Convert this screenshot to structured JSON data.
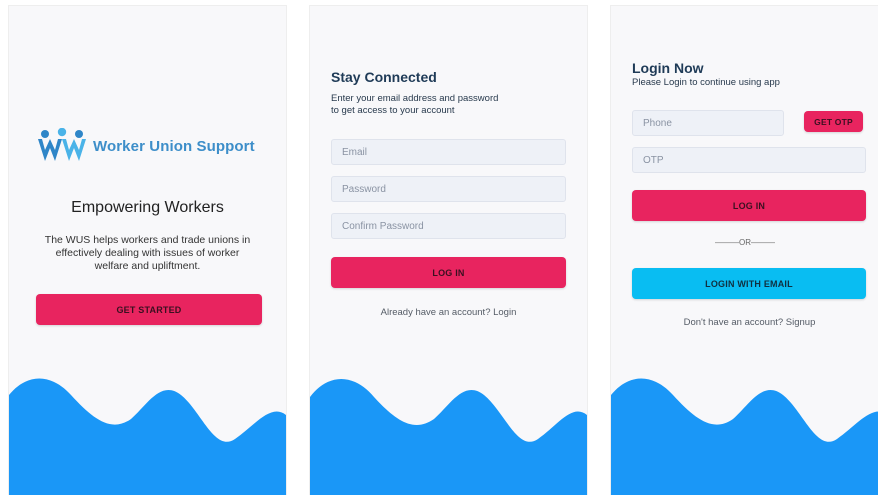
{
  "colors": {
    "wave": "#1a97f7",
    "primary_button": "#e8245f",
    "secondary_button": "#09bdf2",
    "logo_blue": "#3d8ec9"
  },
  "screen1": {
    "logo_icon": "people-hands-logo-icon",
    "app_name": "Worker Union Support",
    "title": "Empowering Workers",
    "description": "The WUS helps workers and trade unions in effectively dealing with issues of worker welfare and upliftment.",
    "button_label": "GET STARTED"
  },
  "screen2": {
    "title": "Stay Connected",
    "subtitle_line1": "Enter your email address and password",
    "subtitle_line2": "to get access to your account",
    "email_placeholder": "Email",
    "password_placeholder": "Password",
    "confirm_password_placeholder": "Confirm Password",
    "login_button": "LOG IN",
    "footer_text": "Already have an account? Login"
  },
  "screen3": {
    "title": "Login Now",
    "subtitle": "Please Login to continue using app",
    "phone_placeholder": "Phone",
    "get_otp_button": "GET OTP",
    "otp_placeholder": "OTP",
    "login_button": "LOG IN",
    "divider_text": "———OR———",
    "login_email_button": "LOGIN WITH EMAIL",
    "footer_text": "Don't have an account? Signup"
  }
}
